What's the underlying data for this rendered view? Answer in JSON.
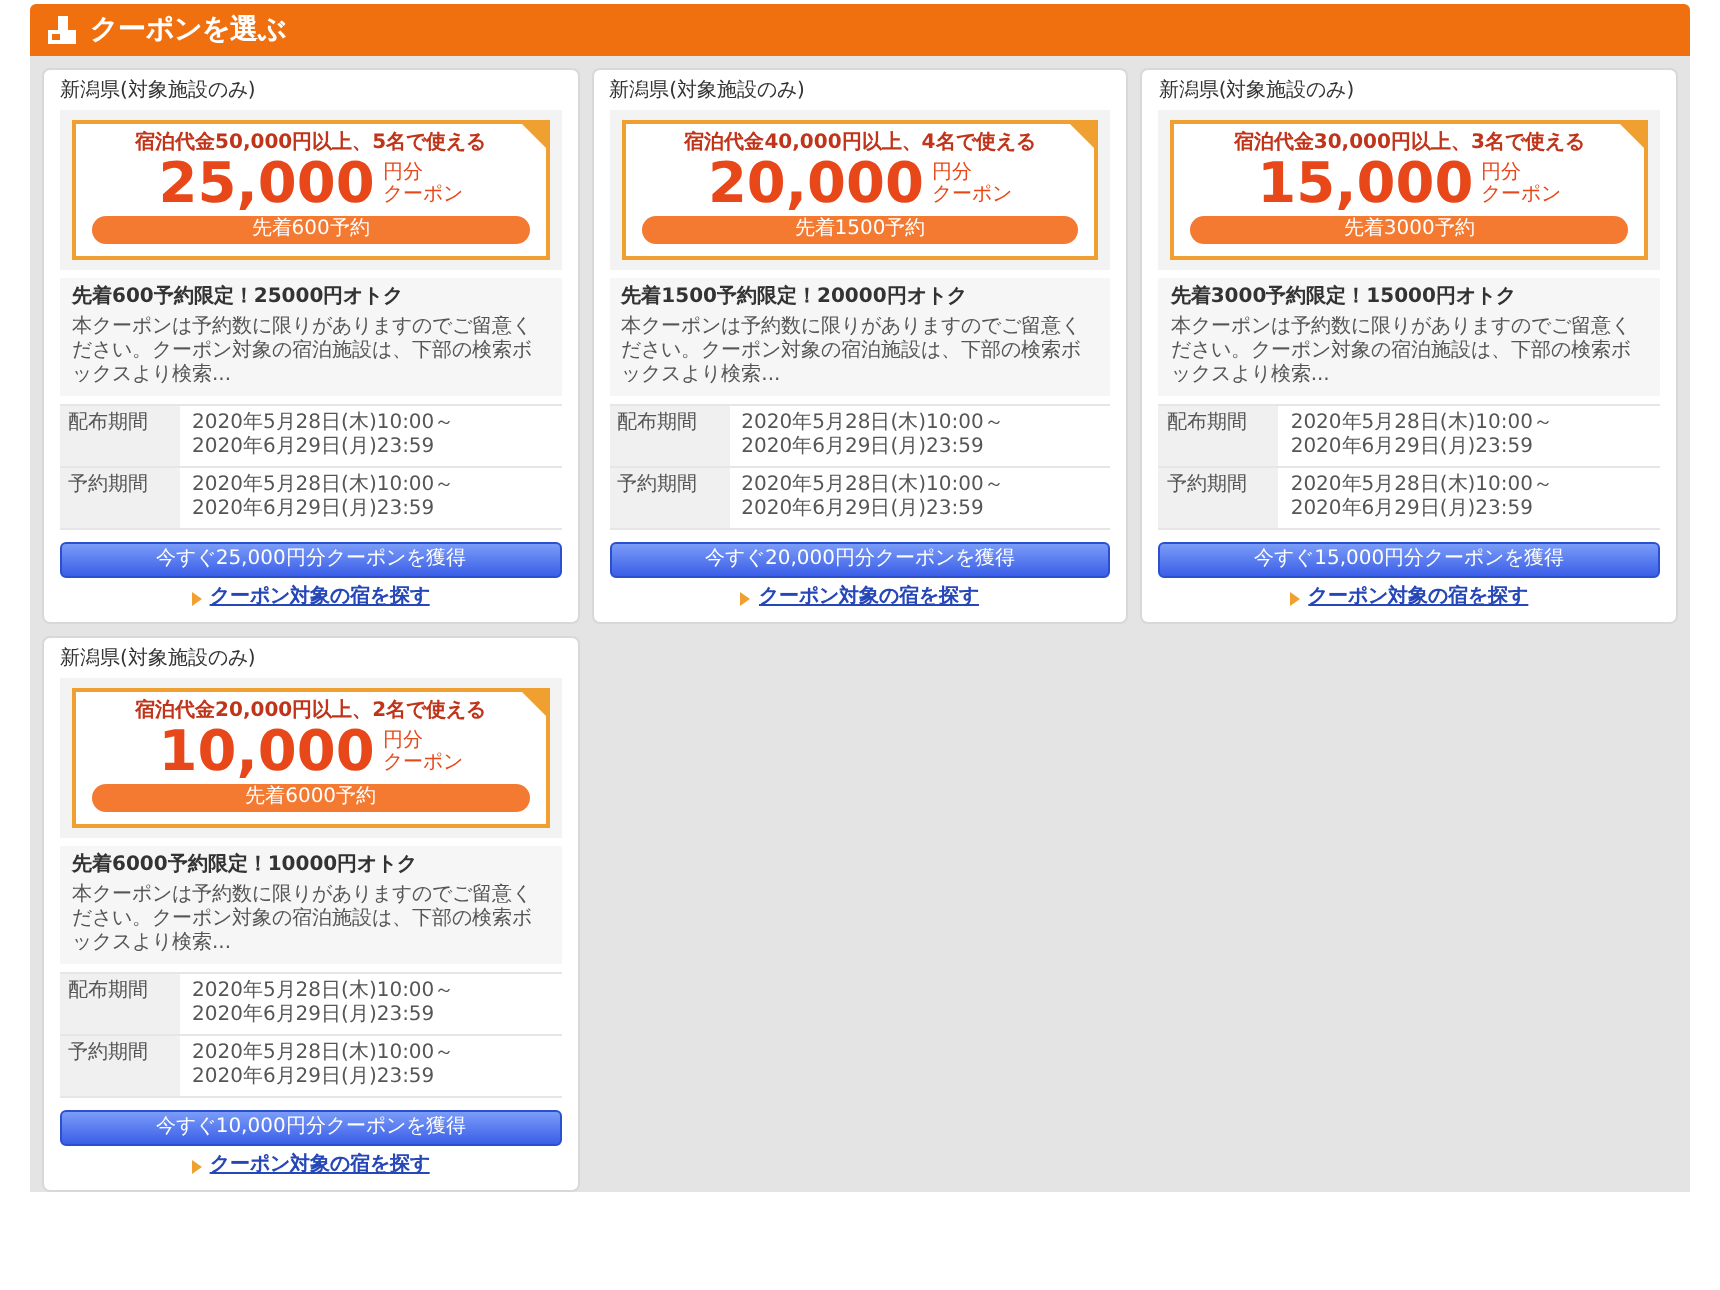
{
  "header": {
    "title": "クーポンを選ぶ"
  },
  "coupons": [
    {
      "region": "新潟県(対象施設のみ)",
      "condition": "宿泊代金50,000円以上、5名で使える",
      "amount": "25,000",
      "unit": "円分",
      "unit_label": "クーポン",
      "limit": "先着600予約",
      "title": "先着600予約限定！25000円オトク",
      "description": "本クーポンは予約数に限りがありますのでご留意ください。クーポン対象の宿泊施設は、下部の検索ボックスより検索...",
      "periods": [
        {
          "label": "配布期間",
          "lines": [
            "2020年5月28日(木)10:00～",
            "2020年6月29日(月)23:59"
          ]
        },
        {
          "label": "予約期間",
          "lines": [
            "2020年5月28日(木)10:00～",
            "2020年6月29日(月)23:59"
          ]
        }
      ],
      "button": "今すぐ25,000円分クーポンを獲得",
      "link": "クーポン対象の宿を探す"
    },
    {
      "region": "新潟県(対象施設のみ)",
      "condition": "宿泊代金40,000円以上、4名で使える",
      "amount": "20,000",
      "unit": "円分",
      "unit_label": "クーポン",
      "limit": "先着1500予約",
      "title": "先着1500予約限定！20000円オトク",
      "description": "本クーポンは予約数に限りがありますのでご留意ください。クーポン対象の宿泊施設は、下部の検索ボックスより検索...",
      "periods": [
        {
          "label": "配布期間",
          "lines": [
            "2020年5月28日(木)10:00～",
            "2020年6月29日(月)23:59"
          ]
        },
        {
          "label": "予約期間",
          "lines": [
            "2020年5月28日(木)10:00～",
            "2020年6月29日(月)23:59"
          ]
        }
      ],
      "button": "今すぐ20,000円分クーポンを獲得",
      "link": "クーポン対象の宿を探す"
    },
    {
      "region": "新潟県(対象施設のみ)",
      "condition": "宿泊代金30,000円以上、3名で使える",
      "amount": "15,000",
      "unit": "円分",
      "unit_label": "クーポン",
      "limit": "先着3000予約",
      "title": "先着3000予約限定！15000円オトク",
      "description": "本クーポンは予約数に限りがありますのでご留意ください。クーポン対象の宿泊施設は、下部の検索ボックスより検索...",
      "periods": [
        {
          "label": "配布期間",
          "lines": [
            "2020年5月28日(木)10:00～",
            "2020年6月29日(月)23:59"
          ]
        },
        {
          "label": "予約期間",
          "lines": [
            "2020年5月28日(木)10:00～",
            "2020年6月29日(月)23:59"
          ]
        }
      ],
      "button": "今すぐ15,000円分クーポンを獲得",
      "link": "クーポン対象の宿を探す"
    },
    {
      "region": "新潟県(対象施設のみ)",
      "condition": "宿泊代金20,000円以上、2名で使える",
      "amount": "10,000",
      "unit": "円分",
      "unit_label": "クーポン",
      "limit": "先着6000予約",
      "title": "先着6000予約限定！10000円オトク",
      "description": "本クーポンは予約数に限りがありますのでご留意ください。クーポン対象の宿泊施設は、下部の検索ボックスより検索...",
      "periods": [
        {
          "label": "配布期間",
          "lines": [
            "2020年5月28日(木)10:00～",
            "2020年6月29日(月)23:59"
          ]
        },
        {
          "label": "予約期間",
          "lines": [
            "2020年5月28日(木)10:00～",
            "2020年6月29日(月)23:59"
          ]
        }
      ],
      "button": "今すぐ10,000円分クーポンを獲得",
      "link": "クーポン対象の宿を探す"
    }
  ]
}
